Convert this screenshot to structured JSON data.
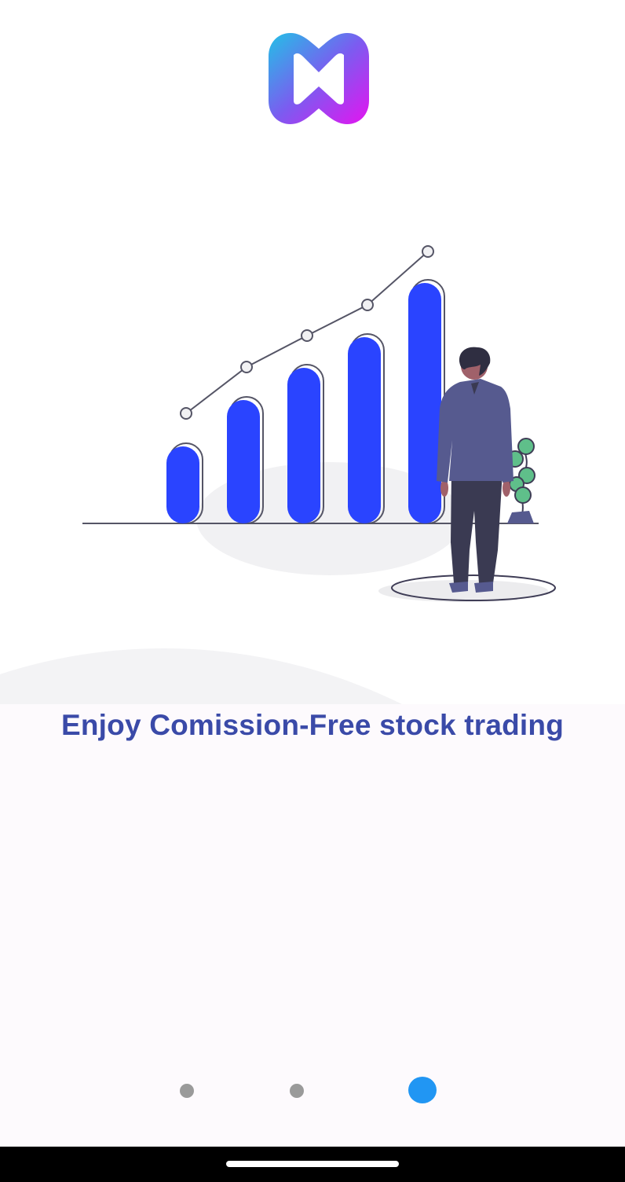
{
  "app": {
    "logo_icon": "brand-logo-icon",
    "brand_gradient": [
      "#22c1e6",
      "#7b5cf0",
      "#e414f0"
    ]
  },
  "illustration": {
    "icon": "growth-chart-person-illustration",
    "bar_color": "#2a44ff",
    "person_jacket_color": "#565a8f",
    "plant_color": "#5fbf8a"
  },
  "onboarding": {
    "headline": "Enjoy Comission-Free stock trading",
    "headline_color": "#3a4aa8",
    "page_count": 3,
    "current_page": 3
  },
  "pager": {
    "active_color": "#2196f3",
    "inactive_color": "#9a9a9a"
  },
  "system": {
    "home_indicator_icon": "home-indicator-bar"
  }
}
